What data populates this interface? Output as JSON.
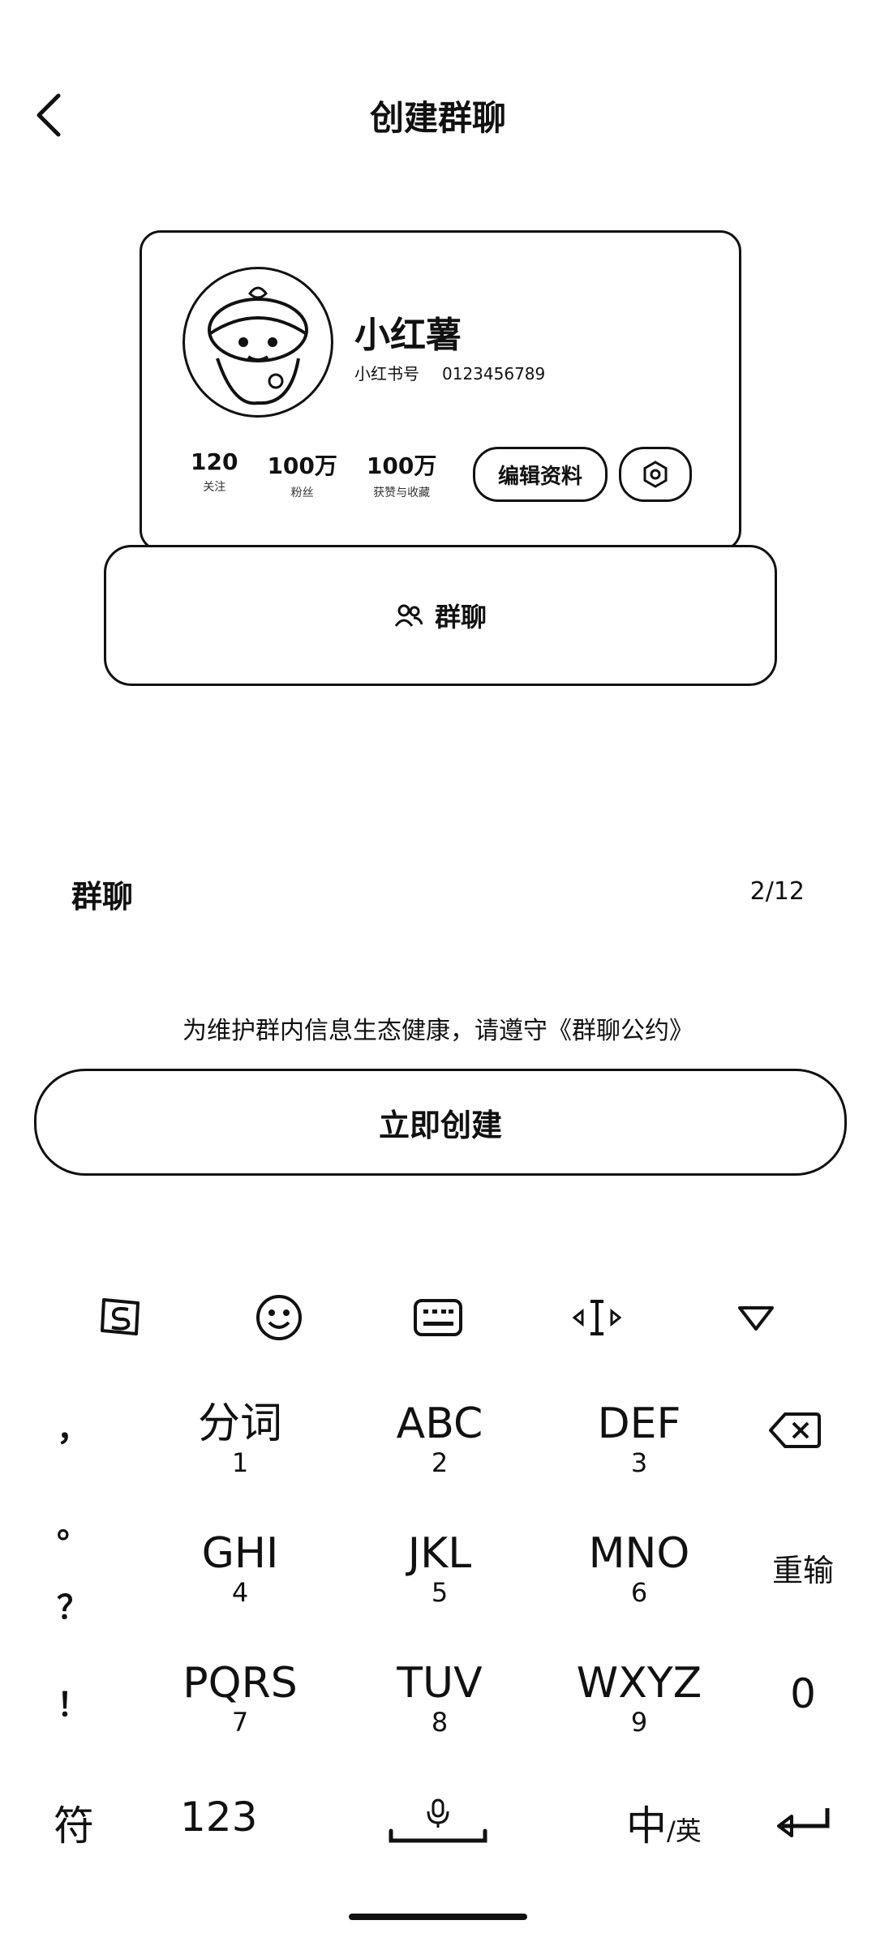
{
  "header": {
    "title": "创建群聊"
  },
  "preview": {
    "nickname": "小红薯",
    "id_label": "小红书号",
    "id_value": "0123456789",
    "stats": [
      {
        "value": "120",
        "label": "关注"
      },
      {
        "value": "100万",
        "label": "粉丝"
      },
      {
        "value": "100万",
        "label": "获赞与收藏"
      }
    ],
    "edit_profile": "编辑资料",
    "group_chat_label": "群聊"
  },
  "group_name": {
    "value": "群聊",
    "count": "2/12"
  },
  "notice": "为维护群内信息生态健康，请遵守《群聊公约》",
  "create_button": "立即创建",
  "keyboard": {
    "toolbar": [
      "sogou-logo-icon",
      "emoji-icon",
      "keyboard-icon",
      "cursor-move-icon",
      "collapse-keyboard-icon"
    ],
    "punctuation": [
      "，",
      "。",
      "？",
      "！"
    ],
    "rows": [
      {
        "main": "分词",
        "sub": "1"
      },
      {
        "main": "ABC",
        "sub": "2"
      },
      {
        "main": "DEF",
        "sub": "3"
      },
      {
        "main": "GHI",
        "sub": "4"
      },
      {
        "main": "JKL",
        "sub": "5"
      },
      {
        "main": "MNO",
        "sub": "6"
      },
      {
        "main": "PQRS",
        "sub": "7"
      },
      {
        "main": "TUV",
        "sub": "8"
      },
      {
        "main": "WXYZ",
        "sub": "9"
      }
    ],
    "reinput": "重输",
    "zero": "0",
    "symbols": "符",
    "numbers": "123",
    "lang_main": "中",
    "lang_alt": "/英"
  }
}
